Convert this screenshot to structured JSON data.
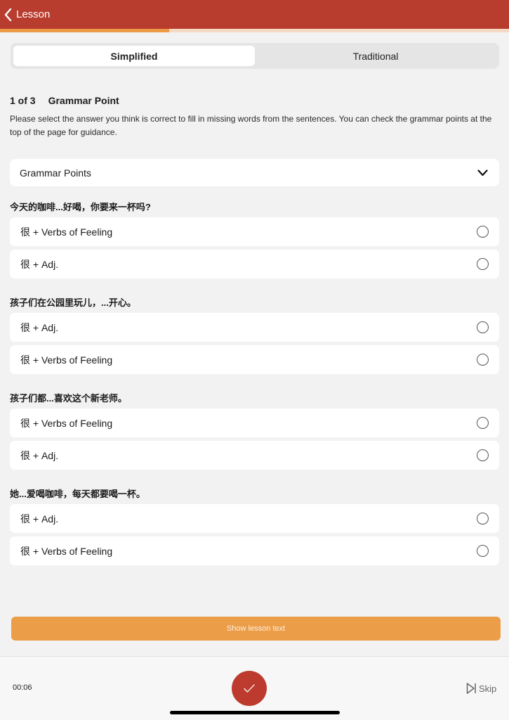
{
  "header": {
    "back_label": "Lesson"
  },
  "progress": {
    "fraction": 0.333,
    "fill_color": "#ec9a45",
    "track_color": "#f6d9c4"
  },
  "script_toggle": {
    "options": [
      "Simplified",
      "Traditional"
    ],
    "selected": "Simplified"
  },
  "section": {
    "count": "1 of 3",
    "title": "Grammar Point",
    "instructions": "Please select the answer you think is correct to fill in missing words from the sentences. You can check the grammar points at the top of the page for guidance."
  },
  "grammar_dropdown": {
    "label": "Grammar Points"
  },
  "questions": [
    {
      "sentence": "今天的咖啡...好喝，你要来一杯吗?",
      "options": [
        "很 + Verbs of Feeling",
        "很 + Adj."
      ]
    },
    {
      "sentence": "孩子们在公园里玩儿，...开心。",
      "options": [
        "很 + Adj.",
        "很 + Verbs of Feeling"
      ]
    },
    {
      "sentence": "孩子们都...喜欢这个新老师。",
      "options": [
        "很 + Verbs of Feeling",
        "很 + Adj."
      ]
    },
    {
      "sentence": "她...爱喝咖啡，每天都要喝一杯。",
      "options": [
        "很 + Adj.",
        "很 + Verbs of Feeling"
      ]
    }
  ],
  "show_lesson_button": {
    "label": "Show lesson text"
  },
  "footer": {
    "timer": "00:06",
    "skip_label": "Skip"
  },
  "colors": {
    "header": "#b93d2f",
    "accent": "#eb9d47",
    "check_button": "#bd3b2e"
  }
}
